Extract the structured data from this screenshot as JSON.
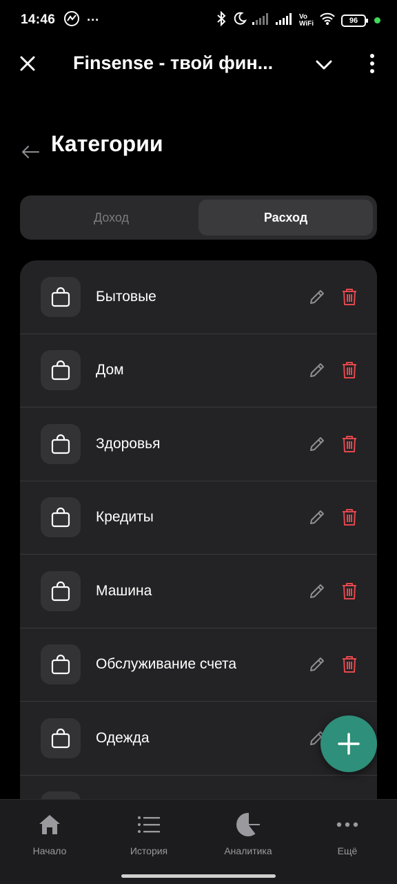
{
  "status_bar": {
    "time": "14:46",
    "more_icon": "···",
    "vowifi_top": "Vo",
    "vowifi_bottom": "WiFi",
    "battery": "96"
  },
  "app_bar": {
    "title": "Finsense - твой фин..."
  },
  "page": {
    "title": "Категории"
  },
  "tabs": [
    {
      "label": "Доход",
      "active": false
    },
    {
      "label": "Расход",
      "active": true
    }
  ],
  "categories": [
    {
      "label": "Бытовые"
    },
    {
      "label": "Дом"
    },
    {
      "label": "Здоровья"
    },
    {
      "label": "Кредиты"
    },
    {
      "label": "Машина"
    },
    {
      "label": "Обслуживание счета"
    },
    {
      "label": "Одежда"
    }
  ],
  "bottom_nav": [
    {
      "label": "Начало",
      "icon": "home-icon"
    },
    {
      "label": "История",
      "icon": "list-icon"
    },
    {
      "label": "Аналитика",
      "icon": "pie-chart-icon"
    },
    {
      "label": "Ещё",
      "icon": "more-horizontal-icon"
    }
  ],
  "colors": {
    "accent": "#2e8f7a",
    "delete": "#e5484d",
    "background": "#000000",
    "card": "#232325"
  }
}
